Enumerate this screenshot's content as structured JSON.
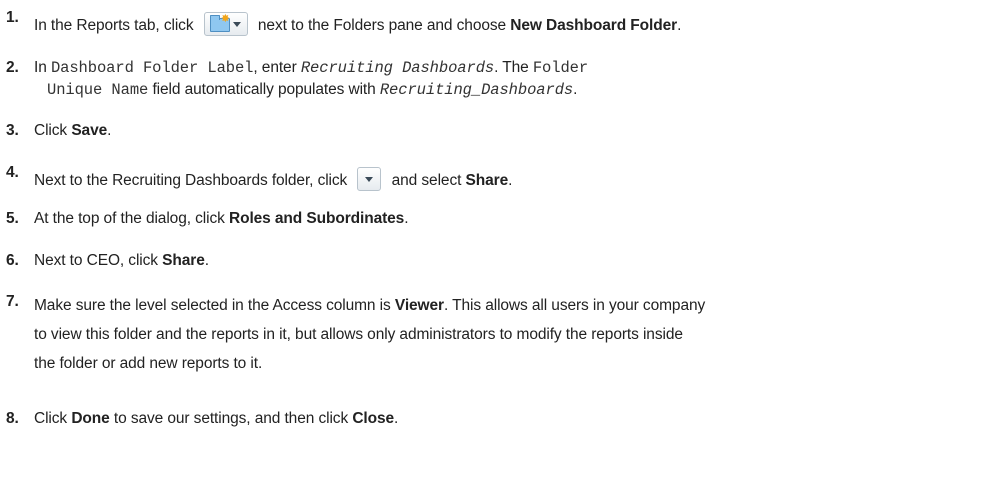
{
  "steps": [
    {
      "num": "1.",
      "a": "In the Reports tab, click",
      "b": "next to the Folders pane and choose",
      "bold": "New Dashboard Folder",
      "end": "."
    },
    {
      "num": "2.",
      "a": "In",
      "field1": "Dashboard Folder Label",
      "b": ", enter",
      "value1": "Recruiting Dashboards",
      "c": ". The",
      "field2a": "Folder",
      "field2b": "Unique Name",
      "d": "field automatically populates with",
      "value2": "Recruiting_Dashboards",
      "end": "."
    },
    {
      "num": "3.",
      "a": "Click",
      "bold": "Save",
      "end": "."
    },
    {
      "num": "4.",
      "a": "Next to the Recruiting Dashboards folder, click",
      "b": "and select",
      "bold": "Share",
      "end": "."
    },
    {
      "num": "5.",
      "a": "At the top of the dialog, click",
      "bold": "Roles and Subordinates",
      "end": "."
    },
    {
      "num": "6.",
      "a": "Next to CEO, click",
      "bold": "Share",
      "end": "."
    },
    {
      "num": "7.",
      "a": "Make sure the level selected in the Access column is",
      "bold": "Viewer",
      "line1rest": ". This allows all users in your company",
      "line2": "to view this folder and the reports in it, but allows only administrators to modify the reports inside",
      "line3": "the folder or add new reports to it."
    },
    {
      "num": "8.",
      "a": "Click",
      "bold1": "Done",
      "b": "to save our settings, and then click",
      "bold2": "Close",
      "end": "."
    }
  ],
  "icons": {
    "new_folder_menu": "new-folder-dropdown-icon",
    "folder_menu": "dropdown-arrow-icon"
  }
}
